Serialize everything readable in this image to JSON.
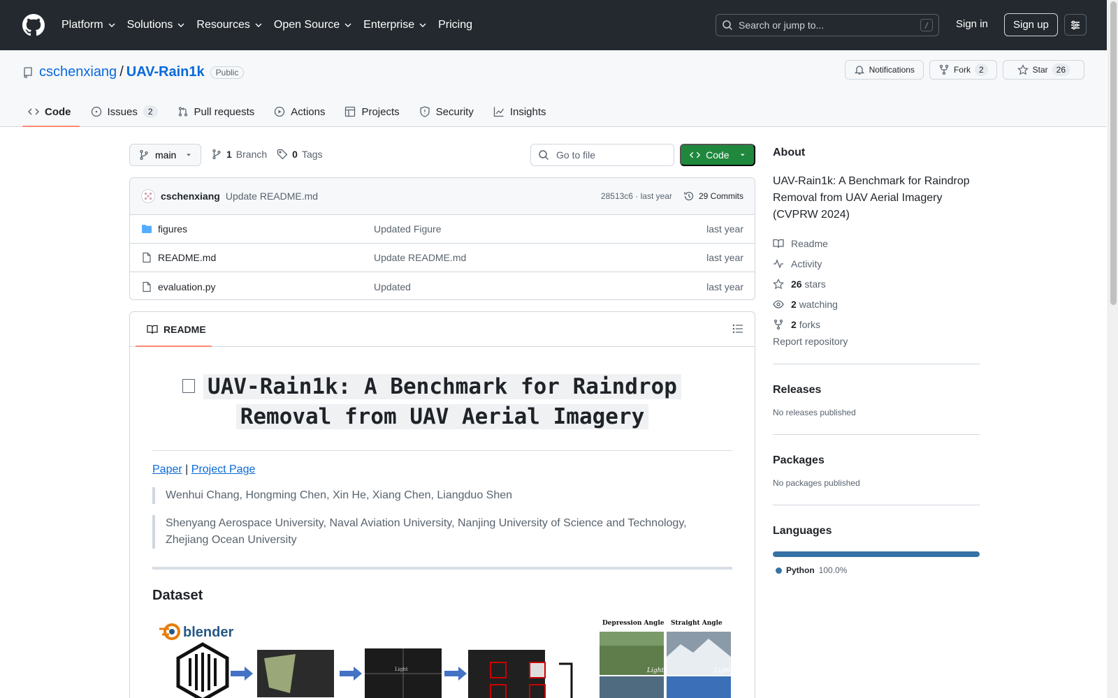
{
  "header": {
    "nav": [
      "Platform",
      "Solutions",
      "Resources",
      "Open Source",
      "Enterprise",
      "Pricing"
    ],
    "search_placeholder": "Search or jump to...",
    "search_shortcut": "/",
    "sign_in": "Sign in",
    "sign_up": "Sign up"
  },
  "repo": {
    "owner": "cschenxiang",
    "separator": "/",
    "name": "UAV-Rain1k",
    "visibility": "Public",
    "notifications_label": "Notifications",
    "fork_label": "Fork",
    "fork_count": "2",
    "star_label": "Star",
    "star_count": "26"
  },
  "tabs": {
    "code": "Code",
    "issues": "Issues",
    "issues_count": "2",
    "pulls": "Pull requests",
    "actions": "Actions",
    "projects": "Projects",
    "security": "Security",
    "insights": "Insights"
  },
  "toolbar": {
    "branch": "main",
    "branch_count": "1",
    "branch_label": "Branch",
    "tag_count": "0",
    "tag_label": "Tags",
    "goto_file": "Go to file",
    "code_button": "Code"
  },
  "commit": {
    "author": "cschenxiang",
    "message": "Update README.md",
    "hash_time": "28513c6 · last year",
    "commits": "29 Commits"
  },
  "files": [
    {
      "name": "figures",
      "message": "Updated Figure",
      "date": "last year",
      "type": "dir"
    },
    {
      "name": "README.md",
      "message": "Update README.md",
      "date": "last year",
      "type": "file"
    },
    {
      "name": "evaluation.py",
      "message": "Updated",
      "date": "last year",
      "type": "file"
    }
  ],
  "readme": {
    "tab_label": "README",
    "title_line1": "UAV-Rain1k: A Benchmark for Raindrop",
    "title_line2": "Removal from UAV Aerial Imagery",
    "link_paper": "Paper",
    "link_sep": "|",
    "link_project": "Project Page",
    "authors": "Wenhui Chang, Hongming Chen, Xin He, Xiang Chen, Liangduo Shen",
    "affiliations": "Shenyang Aerospace University, Naval Aviation University, Nanjing University of Science and Technology, Zhejiang Ocean University",
    "dataset_heading": "Dataset",
    "fig_logo_text": "blender",
    "fig_label_depression": "Depression Angle",
    "fig_label_straight": "Straight Angle",
    "fig_light": "Light"
  },
  "about": {
    "heading": "About",
    "description": "UAV-Rain1k: A Benchmark for Raindrop Removal from UAV Aerial Imagery (CVPRW 2024)",
    "readme": "Readme",
    "activity": "Activity",
    "stars_count": "26",
    "stars_label": "stars",
    "watching_count": "2",
    "watching_label": "watching",
    "forks_count": "2",
    "forks_label": "forks",
    "report": "Report repository"
  },
  "releases": {
    "heading": "Releases",
    "note": "No releases published"
  },
  "packages": {
    "heading": "Packages",
    "note": "No packages published"
  },
  "languages": {
    "heading": "Languages",
    "items": [
      {
        "name": "Python",
        "percent": "100.0%",
        "color": "#3572a5",
        "share": 1.0
      }
    ]
  },
  "colors": {
    "accent": "#0969da",
    "primary_button": "#1f883d",
    "tab_underline": "#fd8c73"
  }
}
